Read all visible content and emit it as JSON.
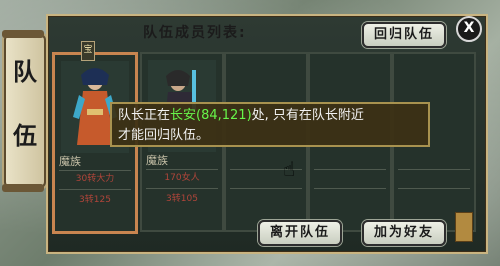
{
  "side_tab": {
    "chars": [
      "队",
      "伍"
    ]
  },
  "title": "队伍成员列表:",
  "buttons": {
    "return_team": "回归队伍",
    "leave_team": "离开队伍",
    "add_friend": "加为好友",
    "close": "X"
  },
  "members": [
    {
      "race": "魔族",
      "stat1": "30转大力",
      "stat2": "3转125",
      "flag": "宝"
    },
    {
      "race": "魔族",
      "stat1": "170女人",
      "stat2": "3转105",
      "flag": ""
    }
  ],
  "tooltip": {
    "part1": "队长正在",
    "place": "长安(84,121)",
    "part2": "处, 只有在队长附近",
    "line2": "才能回归队伍。"
  }
}
